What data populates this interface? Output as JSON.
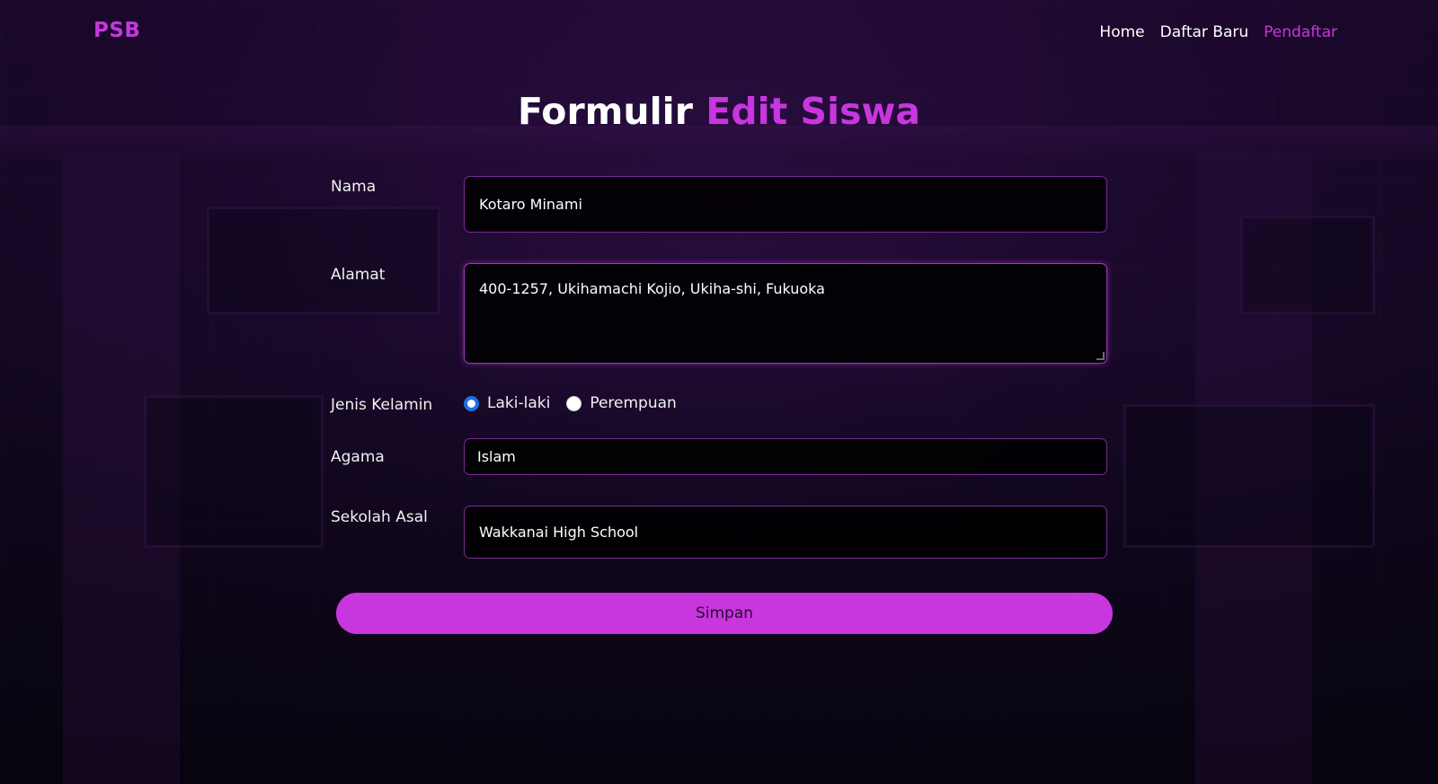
{
  "navbar": {
    "brand": "PSB",
    "links": [
      {
        "label": "Home",
        "active": false
      },
      {
        "label": "Daftar Baru",
        "active": false
      },
      {
        "label": "Pendaftar",
        "active": true
      }
    ]
  },
  "page": {
    "title_prefix": "Formulir",
    "title_accent": "Edit Siswa"
  },
  "form": {
    "nama": {
      "label": "Nama",
      "value": "Kotaro Minami"
    },
    "alamat": {
      "label": "Alamat",
      "value": "400-1257, Ukihamachi Kojio, Ukiha-shi, Fukuoka"
    },
    "jenis_kelamin": {
      "label": "Jenis Kelamin",
      "options": [
        {
          "label": "Laki-laki",
          "checked": true
        },
        {
          "label": "Perempuan",
          "checked": false
        }
      ]
    },
    "agama": {
      "label": "Agama",
      "value": "Islam"
    },
    "sekolah_asal": {
      "label": "Sekolah Asal",
      "value": "Wakkanai High School"
    },
    "submit_label": "Simpan"
  },
  "colors": {
    "accent": "#c836de",
    "radio_checked": "#1f6fe5"
  }
}
